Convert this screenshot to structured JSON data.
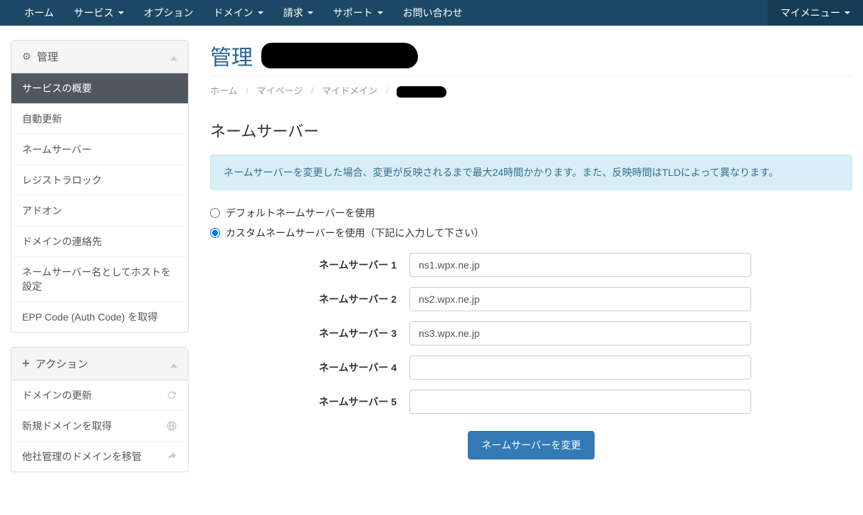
{
  "topnav": {
    "left": [
      {
        "label": "ホーム",
        "caret": false
      },
      {
        "label": "サービス",
        "caret": true
      },
      {
        "label": "オプション",
        "caret": false
      },
      {
        "label": "ドメイン",
        "caret": true
      },
      {
        "label": "請求",
        "caret": true
      },
      {
        "label": "サポート",
        "caret": true
      },
      {
        "label": "お問い合わせ",
        "caret": false
      }
    ],
    "my_menu": "マイメニュー"
  },
  "sidebar": {
    "panel_manage": {
      "title": "管理",
      "items": [
        "サービスの概要",
        "自動更新",
        "ネームサーバー",
        "レジストラロック",
        "アドオン",
        "ドメインの連絡先",
        "ネームサーバー名としてホストを設定",
        "EPP Code (Auth Code) を取得"
      ],
      "active_index": 0
    },
    "panel_actions": {
      "title": "アクション",
      "items": [
        {
          "label": "ドメインの更新",
          "icon": "refresh"
        },
        {
          "label": "新規ドメインを取得",
          "icon": "globe"
        },
        {
          "label": "他社管理のドメインを移管",
          "icon": "share"
        }
      ]
    }
  },
  "main": {
    "page_title": "管理",
    "breadcrumb": [
      "ホーム",
      "マイページ",
      "マイドメイン"
    ],
    "section_title": "ネームサーバー",
    "info_alert": "ネームサーバーを変更した場合、変更が反映されるまで最大24時間かかります。また、反映時間はTLDによって異なります。",
    "radio": {
      "default_label": "デフォルトネームサーバーを使用",
      "custom_label": "カスタムネームサーバーを使用（下記に入力して下さい）",
      "selected": "custom"
    },
    "nameservers": {
      "labels": [
        "ネームサーバー 1",
        "ネームサーバー 2",
        "ネームサーバー 3",
        "ネームサーバー 4",
        "ネームサーバー 5"
      ],
      "values": [
        "ns1.wpx.ne.jp",
        "ns2.wpx.ne.jp",
        "ns3.wpx.ne.jp",
        "",
        ""
      ]
    },
    "submit_label": "ネームサーバーを変更"
  }
}
